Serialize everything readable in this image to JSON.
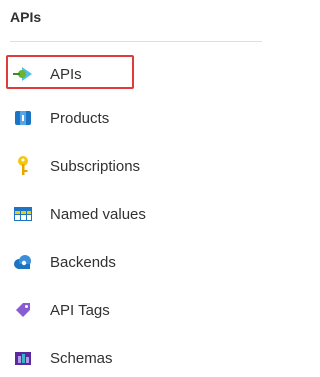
{
  "section": {
    "title": "APIs"
  },
  "nav": {
    "items": [
      {
        "label": "APIs",
        "icon": "api-icon",
        "selected": true
      },
      {
        "label": "Products",
        "icon": "products-icon"
      },
      {
        "label": "Subscriptions",
        "icon": "key-icon"
      },
      {
        "label": "Named values",
        "icon": "table-icon"
      },
      {
        "label": "Backends",
        "icon": "cloud-icon"
      },
      {
        "label": "API Tags",
        "icon": "tag-icon"
      },
      {
        "label": "Schemas",
        "icon": "schema-icon"
      }
    ]
  },
  "colors": {
    "selection_border": "#e03a3a",
    "text": "#323130"
  }
}
